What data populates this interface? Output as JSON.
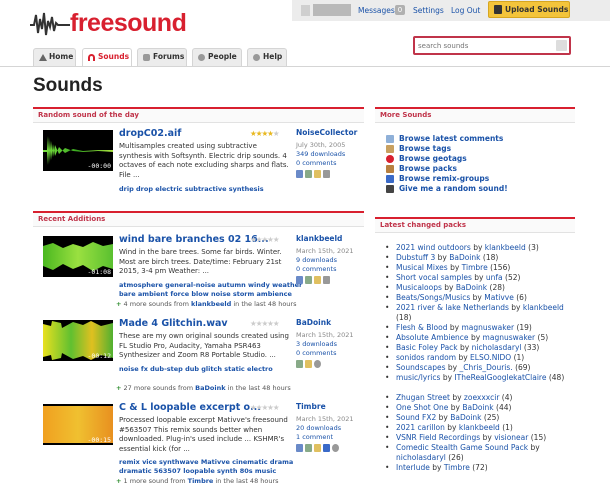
{
  "site": {
    "name": "freesound",
    "brand_color": "#d8202f"
  },
  "userbar": {
    "messages_label": "Messages",
    "messages_count": "0",
    "settings_label": "Settings",
    "logout_label": "Log Out",
    "upload_label": "Upload Sounds",
    "upload_color": "#f3c43b"
  },
  "nav": {
    "tabs": [
      {
        "label": "Home",
        "icon": "home-icon"
      },
      {
        "label": "Sounds",
        "icon": "headphones-icon",
        "active": true
      },
      {
        "label": "Forums",
        "icon": "speech-bubble-icon"
      },
      {
        "label": "People",
        "icon": "people-icon"
      },
      {
        "label": "Help",
        "icon": "help-icon"
      }
    ]
  },
  "search": {
    "placeholder": "search sounds"
  },
  "page": {
    "title": "Sounds"
  },
  "random": {
    "heading": "Random sound of the day",
    "title": "dropC02.aif",
    "description": "Multisamples created using subtractive synthesis with Softsynth. Electric drip sounds. 4 octaves of each note excluding sharps and flats. File ...",
    "tags": "drip drop electric subtractive synthesis",
    "user": "NoiseCollector",
    "date": "July 30th, 2005",
    "downloads": "349 downloads",
    "comments": "0 comments",
    "duration": "-00:00",
    "rating": 4
  },
  "recent": {
    "heading": "Recent Additions",
    "items": [
      {
        "title": "wind bare branches 02 16...",
        "description": "Wind in the bare trees. Some far birds. Winter. Most are birch trees. Date/time: February 21st 2015, 3-4 pm Weather: ...",
        "tags1": "atmosphere general-noise autumn windy weather",
        "tags2": "bare ambient force blow noise storm ambience",
        "user": "klankbeeld",
        "date": "March 15th, 2021",
        "downloads": "9 downloads",
        "comments": "0 comments",
        "duration": "-01:08",
        "more_prefix": "4 more sounds from",
        "more_user": "klankbeeld",
        "more_suffix": "in the last 48 hours"
      },
      {
        "title": "Made 4 Glitchin.wav",
        "description": "These are my own original sounds created using FL Studio Pro, Audacity, Yamaha PSR463 Synthesizer and Zoom R8 Portable Studio. ...",
        "tags1": "noise fx dub-step dub glitch static electro",
        "tags2": "",
        "user": "BaDoink",
        "date": "March 15th, 2021",
        "downloads": "3 downloads",
        "comments": "0 comments",
        "duration": "-00:12",
        "more_prefix": "27 more sounds from",
        "more_user": "BaDoink",
        "more_suffix": "in the last 48 hours"
      },
      {
        "title": "C & L loopable excerpt o...",
        "description": "Processed loopable excerpt Mativve's freesound #563507 This remix sounds better when downloaded. Plug-in's used include ... KSHMR's essential kick (for ...",
        "tags1": "remix vice synthwave Mativve cinematic drama",
        "tags2": "dramatic 563507 loopable synth 80s music",
        "user": "Timbre",
        "date": "March 15th, 2021",
        "downloads": "20 downloads",
        "comments": "1 comment",
        "duration": "-00:15",
        "more_prefix": "1 more sound from",
        "more_user": "Timbre",
        "more_suffix": "in the last 48 hours"
      }
    ]
  },
  "more_sounds": {
    "heading": "More Sounds",
    "items": [
      {
        "label": "Browse latest comments",
        "icon": "comment-icon",
        "color": "#8fb0d8"
      },
      {
        "label": "Browse tags",
        "icon": "tag-icon",
        "color": "#c8a060"
      },
      {
        "label": "Browse geotags",
        "icon": "pushpin-icon",
        "color": "#d8202f"
      },
      {
        "label": "Browse packs",
        "icon": "package-icon",
        "color": "#b88040"
      },
      {
        "label": "Browse remix-groups",
        "icon": "remix-icon",
        "color": "#3a6ac8"
      },
      {
        "label": "Give me a random sound!",
        "icon": "speaker-icon",
        "color": "#444"
      }
    ]
  },
  "packs": {
    "heading": "Latest changed packs",
    "by": "by",
    "items": [
      {
        "name": "2021 wind outdoors",
        "user": "klankbeeld",
        "count": "(3)"
      },
      {
        "name": "Dubstuff 3",
        "user": "BaDoink",
        "count": "(18)"
      },
      {
        "name": "Musical Mixes",
        "user": "Timbre",
        "count": "(156)"
      },
      {
        "name": "Short vocal samples",
        "user": "unfa",
        "count": "(52)"
      },
      {
        "name": "Musicaloops",
        "user": "BaDoink",
        "count": "(28)"
      },
      {
        "name": "Beats/Songs/Musics",
        "user": "Mativve",
        "count": "(6)"
      },
      {
        "name": "2021 river & lake Netherlands",
        "user": "klankbeeld",
        "count": "(18)"
      },
      {
        "name": "Flesh & Blood",
        "user": "magnuswaker",
        "count": "(19)"
      },
      {
        "name": "Absolute Ambience",
        "user": "magnuswaker",
        "count": "(5)"
      },
      {
        "name": "Basic Foley Pack",
        "user": "nicholasdaryl",
        "count": "(33)"
      },
      {
        "name": "sonidos random",
        "user": "ELSO.NIDO",
        "count": "(1)"
      },
      {
        "name": "Soundscapes",
        "user": "_Chris_Douris.",
        "count": "(69)"
      },
      {
        "name": "music/lyrics",
        "user": "ITheRealGooglekatClaire",
        "count": "(48)"
      },
      {
        "name": "Zhugan Street",
        "user": "zoexxxcir",
        "count": "(4)"
      },
      {
        "name": "One Shot One",
        "user": "BaDoink",
        "count": "(44)"
      },
      {
        "name": "Sound FX2",
        "user": "BaDoink",
        "count": "(25)"
      },
      {
        "name": "2021 carillon",
        "user": "klankbeeld",
        "count": "(1)"
      },
      {
        "name": "VSNR Field Recordings",
        "user": "visionear",
        "count": "(15)"
      },
      {
        "name": "Comedic Stealth Game Sound Pack",
        "user": "nicholasdaryl",
        "count": "(26)"
      },
      {
        "name": "Interlude",
        "user": "Timbre",
        "count": "(72)"
      }
    ]
  }
}
